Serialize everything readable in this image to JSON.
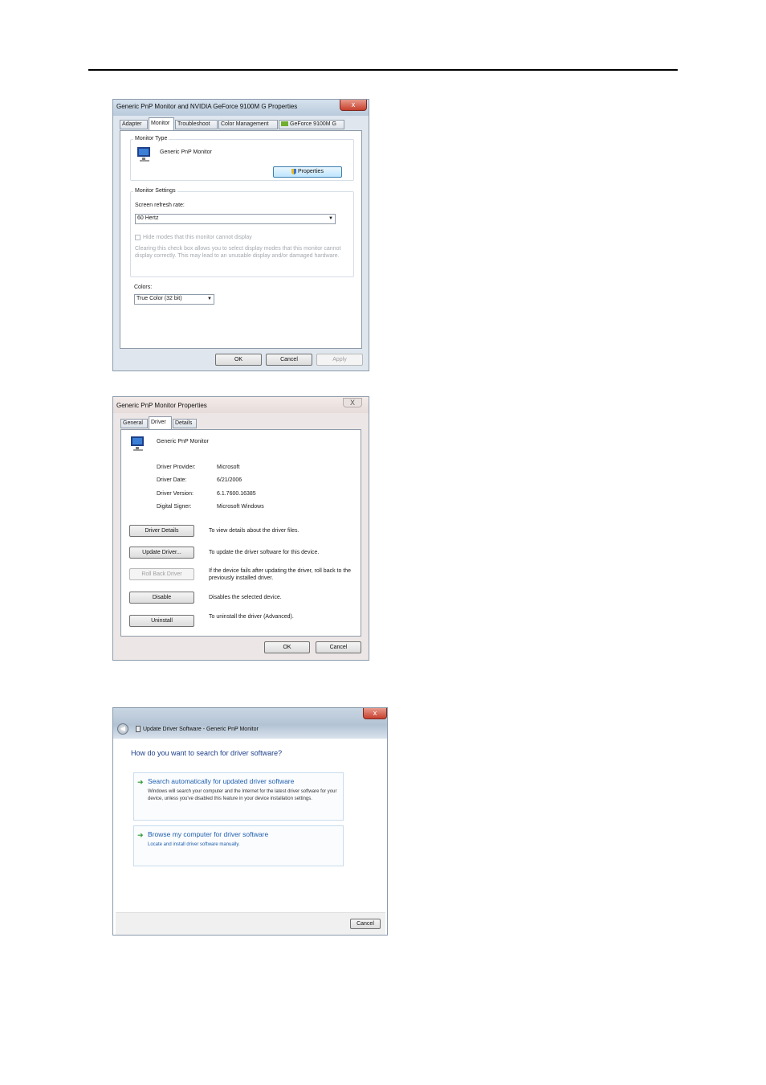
{
  "window1": {
    "title": "Generic PnP Monitor and NVIDIA GeForce 9100M G   Properties",
    "close": "x",
    "tabs": [
      "Adapter",
      "Monitor",
      "Troubleshoot",
      "Color Management",
      "GeForce 9100M G"
    ],
    "monitor_type_label": "Monitor Type",
    "monitor_name": "Generic PnP Monitor",
    "properties_button": "Properties",
    "monitor_settings_label": "Monitor Settings",
    "refresh_rate_label": "Screen refresh rate:",
    "refresh_rate_value": "60 Hertz",
    "hide_modes_label": "Hide modes that this monitor cannot display",
    "hide_modes_desc": "Clearing this check box allows you to select display modes that this monitor cannot display correctly. This may lead to an unusable display and/or damaged hardware.",
    "colors_label": "Colors:",
    "colors_value": "True Color (32 bit)",
    "ok": "OK",
    "cancel": "Cancel",
    "apply": "Apply"
  },
  "window2": {
    "title": "Generic PnP Monitor Properties",
    "close": "X",
    "tabs": [
      "General",
      "Driver",
      "Details"
    ],
    "device_name": "Generic PnP Monitor",
    "provider_label": "Driver Provider:",
    "provider_value": "Microsoft",
    "date_label": "Driver Date:",
    "date_value": "6/21/2006",
    "version_label": "Driver Version:",
    "version_value": "6.1.7600.16385",
    "signer_label": "Digital Signer:",
    "signer_value": "Microsoft Windows",
    "actions": [
      {
        "button": "Driver Details",
        "desc": "To view details about the driver files."
      },
      {
        "button": "Update Driver...",
        "desc": "To update the driver software for this device."
      },
      {
        "button": "Roll Back Driver",
        "desc": "If the device fails after updating the driver, roll back to the previously installed driver."
      },
      {
        "button": "Disable",
        "desc": "Disables the selected device."
      },
      {
        "button": "Uninstall",
        "desc": "To uninstall the driver (Advanced)."
      }
    ],
    "ok": "OK",
    "cancel": "Cancel"
  },
  "window3": {
    "title": "Update Driver Software - Generic PnP Monitor",
    "close": "x",
    "question": "How do you want to search for driver software?",
    "option1_title": "Search automatically for updated driver software",
    "option1_desc": "Windows will search your computer and the Internet for the latest driver software for your device, unless you've disabled this feature in your device installation settings.",
    "option2_title": "Browse my computer for driver software",
    "option2_desc": "Locate and install driver software manually.",
    "cancel": "Cancel"
  },
  "icons": {
    "arrow": "➜",
    "caret": "▼",
    "back": "◀"
  }
}
